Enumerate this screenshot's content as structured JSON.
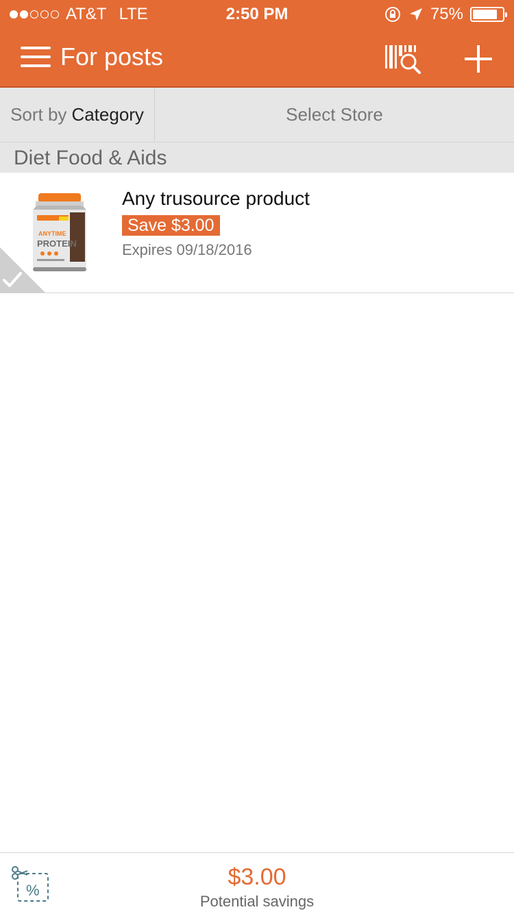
{
  "status": {
    "carrier": "AT&T",
    "network": "LTE",
    "time": "2:50 PM",
    "battery": "75%",
    "battery_level": 0.75,
    "signal_bars_filled": 2,
    "signal_bars_total": 5
  },
  "nav": {
    "title": "For posts",
    "menu_icon": "hamburger-menu-icon",
    "scan_icon": "barcode-search-icon",
    "add_icon": "plus-icon"
  },
  "filters": {
    "sort_label": "Sort by",
    "sort_value": "Category",
    "store_label": "Select Store"
  },
  "category": {
    "name": "Diet Food & Aids"
  },
  "coupons": [
    {
      "title": "Any trusource product",
      "save": "Save $3.00",
      "expires": "Expires 09/18/2016",
      "image": "protein-tub-image",
      "product_label_brand": "ANYTIME",
      "product_label_name": "PROTEIN"
    }
  ],
  "footer": {
    "savings_amount": "$3.00",
    "savings_label": "Potential savings",
    "clip_icon": "scissors-coupon-icon"
  },
  "colors": {
    "accent": "#E46B34",
    "header_gray": "#E6E6E6"
  }
}
